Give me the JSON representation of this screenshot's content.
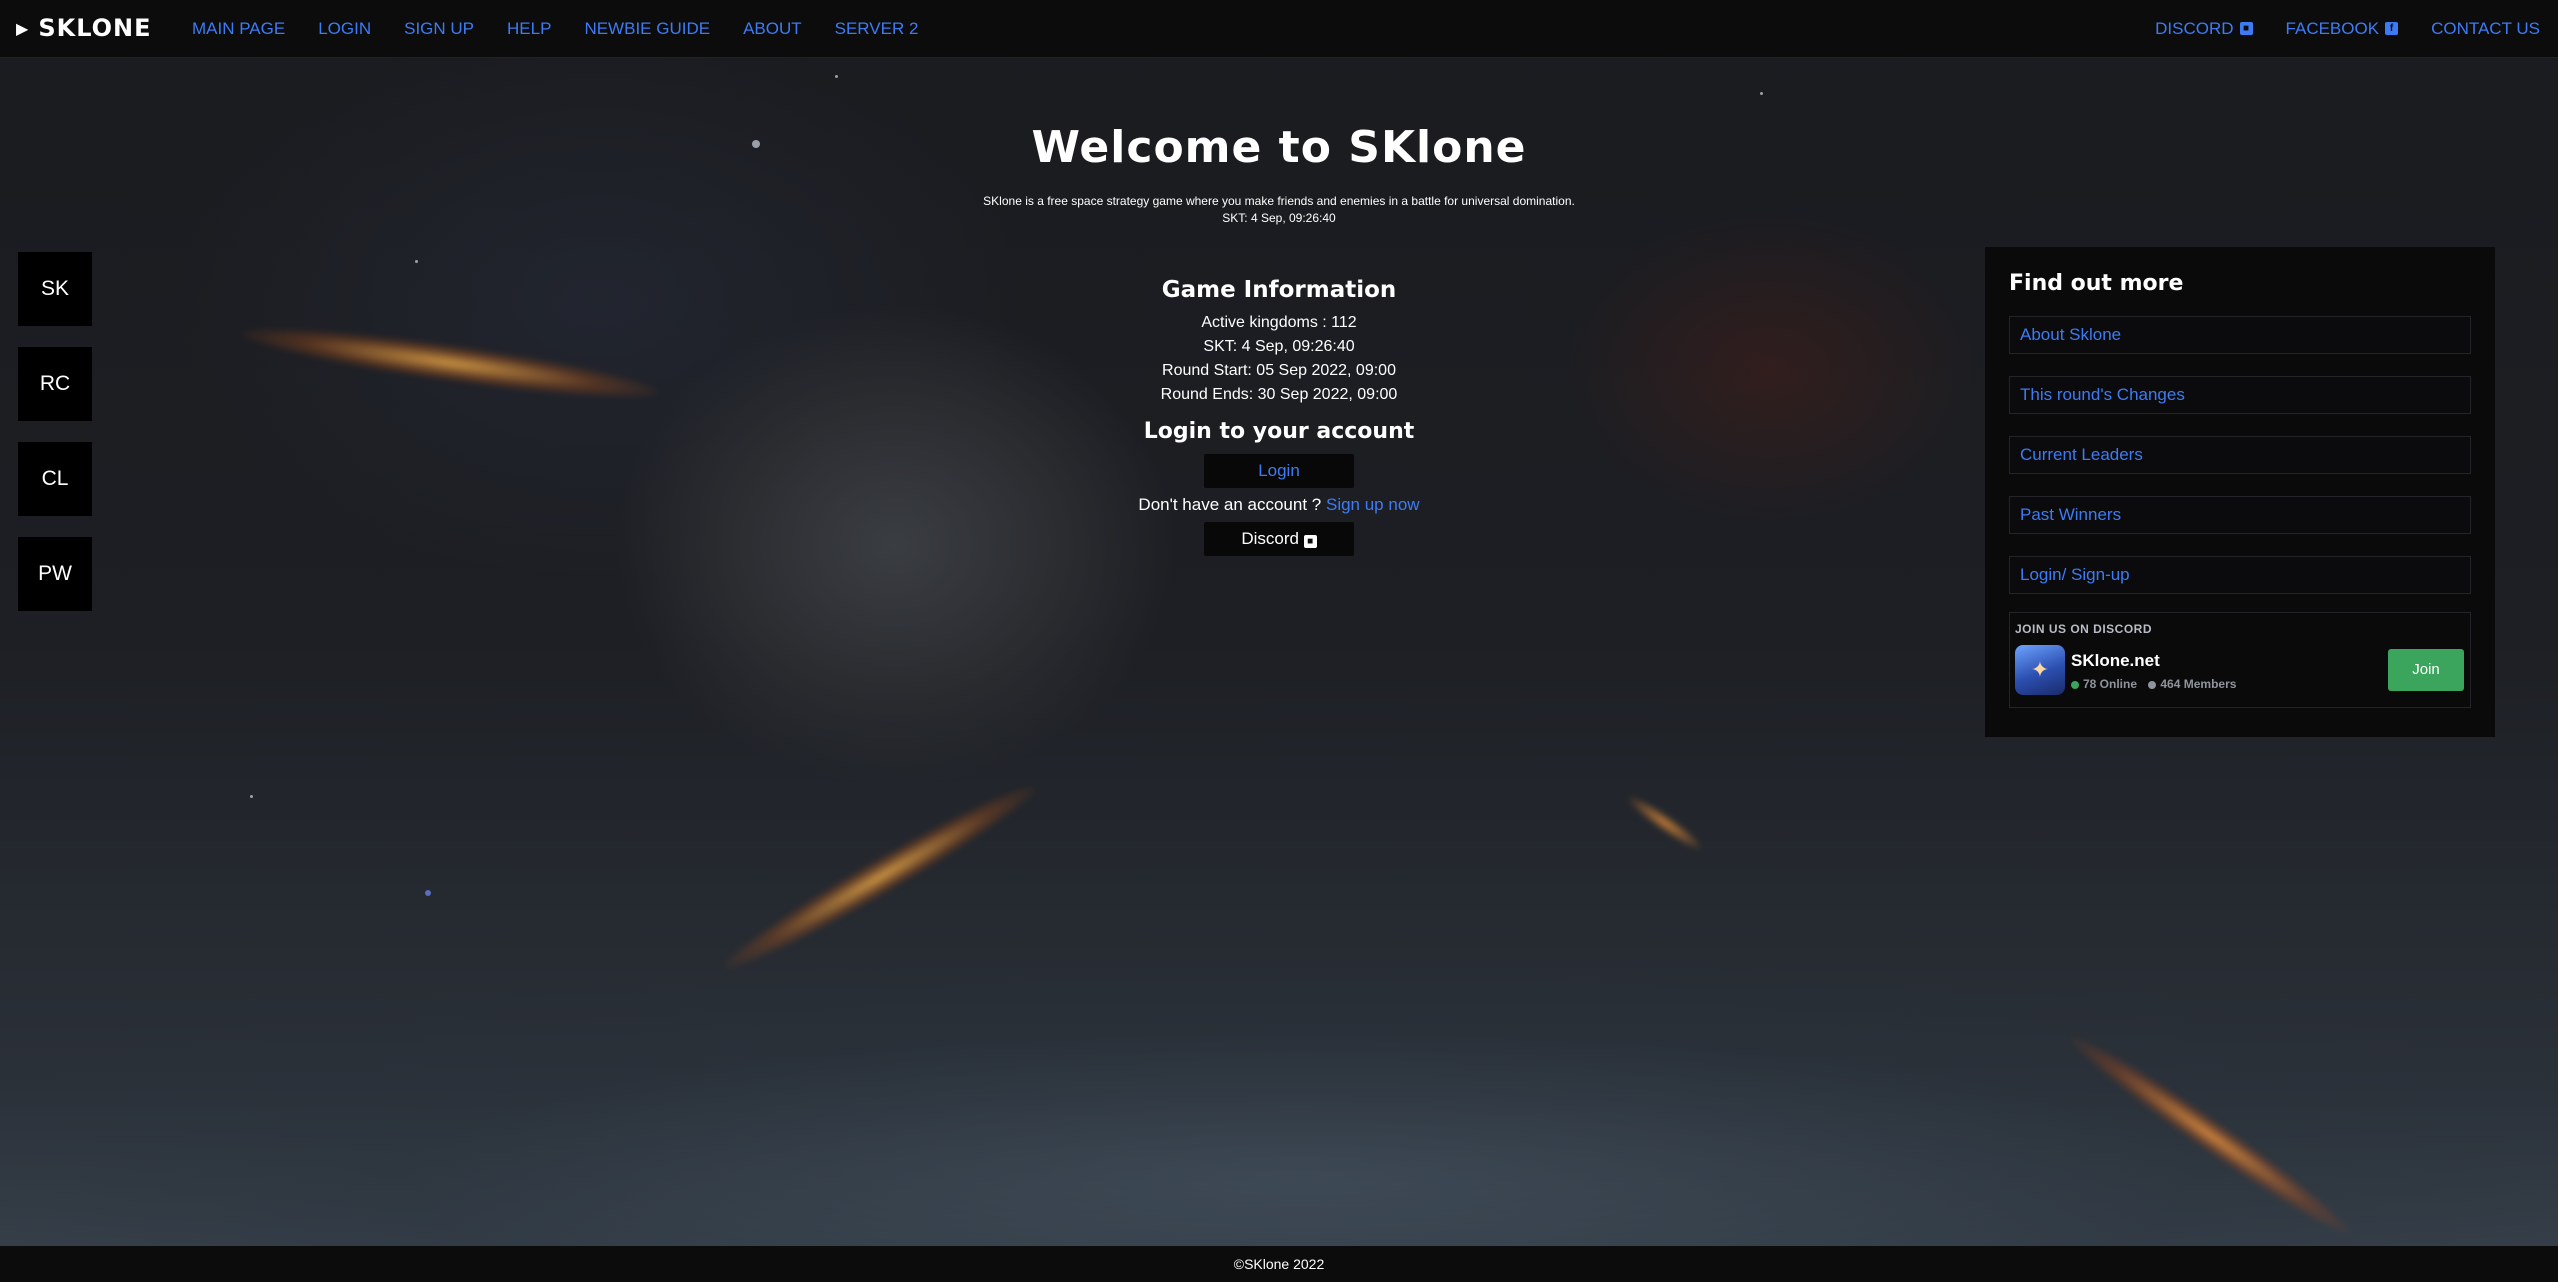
{
  "nav": {
    "brand": "SKLONE",
    "brand_icon": "ship-icon",
    "left_links": [
      "MAIN PAGE",
      "LOGIN",
      "SIGN UP",
      "HELP",
      "NEWBIE GUIDE",
      "ABOUT",
      "SERVER 2"
    ],
    "discord_label": "DISCORD",
    "facebook_label": "FACEBOOK",
    "contact_label": "CONTACT US",
    "link_color": "#3d7bf5"
  },
  "side": [
    "SK",
    "RC",
    "CL",
    "PW"
  ],
  "hero": {
    "title": "Welcome to SKlone",
    "tagline": "SKlone is a free space strategy game where you make friends and enemies in a battle for universal domination.",
    "time": "SKT: 4 Sep, 09:26:40"
  },
  "game_info": {
    "heading": "Game Information",
    "lines": [
      "Active kingdoms : 112",
      "SKT: 4 Sep, 09:26:40",
      "Round Start: 05 Sep 2022, 09:00",
      "Round Ends: 30 Sep 2022, 09:00"
    ]
  },
  "login": {
    "heading": "Login to your account",
    "button": "Login",
    "signup_prompt": "Don't have an account ?",
    "signup_link": "Sign up now",
    "discord_button": "Discord"
  },
  "panel": {
    "title": "Find out more",
    "links": [
      "About Sklone",
      "This round's Changes",
      "Current Leaders",
      "Past Winners",
      "Login/ Sign-up"
    ]
  },
  "discord_widget": {
    "heading": "JOIN US ON DISCORD",
    "server_name": "SKlone.net",
    "online": "78 Online",
    "members": "464 Members",
    "join_label": "Join",
    "accent": "#3ba55d"
  },
  "footer": {
    "text": "©SKlone 2022"
  }
}
